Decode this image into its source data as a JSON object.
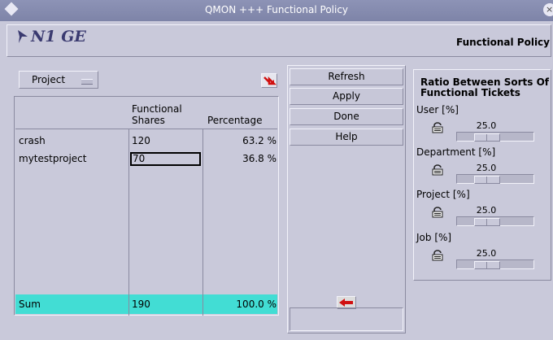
{
  "window": {
    "title": "QMON +++ Functional Policy"
  },
  "header": {
    "logo": "N1 GE",
    "title": "Functional Policy"
  },
  "selector": {
    "value": "Project"
  },
  "table": {
    "columns": [
      {
        "line1": "Functional",
        "line2": "Shares"
      },
      {
        "line1": "",
        "line2": "Percentage"
      }
    ],
    "rows": [
      {
        "name": "crash",
        "shares": "120",
        "percentage": "63.2 %"
      },
      {
        "name": "mytestproject",
        "shares": "70",
        "percentage": "36.8 %"
      }
    ],
    "sum": {
      "label": "Sum",
      "shares": "190",
      "percentage": "100.0 %"
    }
  },
  "buttons": {
    "refresh": "Refresh",
    "apply": "Apply",
    "done": "Done",
    "help": "Help"
  },
  "ratio": {
    "title": "Ratio Between Sorts Of Functional Tickets",
    "items": [
      {
        "label": "User [%]",
        "value": "25.0"
      },
      {
        "label": "Department [%]",
        "value": "25.0"
      },
      {
        "label": "Project [%]",
        "value": "25.0"
      },
      {
        "label": "Job [%]",
        "value": "25.0"
      }
    ]
  },
  "colors": {
    "sum_row": "#42ddd4",
    "titlebar": "#8d93b6",
    "accent_red": "#d01010"
  }
}
